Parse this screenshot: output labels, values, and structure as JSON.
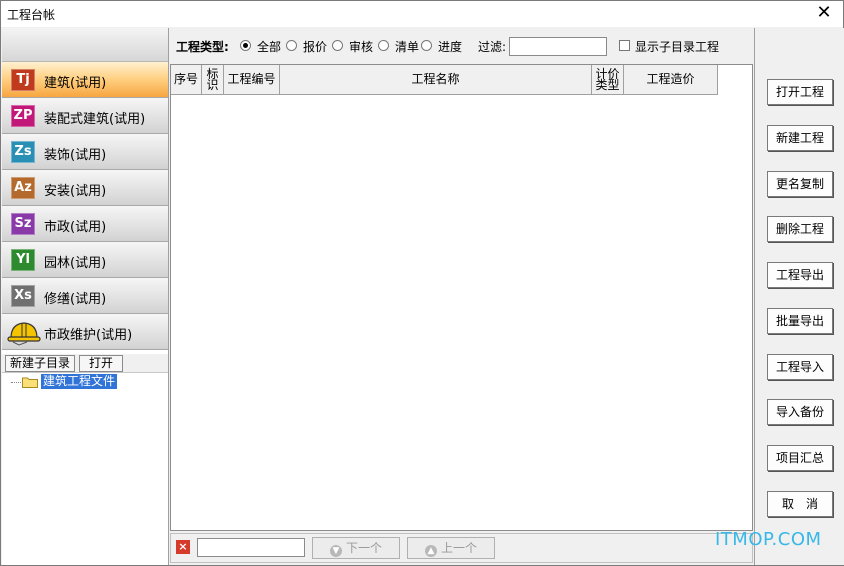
{
  "window": {
    "title": "工程台帐",
    "close_glyph": "✕"
  },
  "sidebar": {
    "categories": [
      {
        "badge": "Tj",
        "label": "建筑(试用)",
        "color": "#c03a1e"
      },
      {
        "badge": "ZP",
        "label": "装配式建筑(试用)",
        "color": "#c2187a"
      },
      {
        "badge": "Zs",
        "label": "装饰(试用)",
        "color": "#2a8fb5"
      },
      {
        "badge": "Az",
        "label": "安装(试用)",
        "color": "#b36a2c"
      },
      {
        "badge": "Sz",
        "label": "市政(试用)",
        "color": "#8a3aa8"
      },
      {
        "badge": "Yl",
        "label": "园林(试用)",
        "color": "#2e8a2e"
      },
      {
        "badge": "Xs",
        "label": "修缮(试用)",
        "color": "#707070"
      },
      {
        "badge": "",
        "label": "市政维护(试用)",
        "icon": "hardhat-icon"
      }
    ],
    "tree_tools": {
      "new_subdir": "新建子目录",
      "open": "打开"
    },
    "tree": {
      "root_label": "建筑工程文件"
    }
  },
  "filter": {
    "type_label": "工程类型:",
    "options": [
      "全部",
      "报价",
      "审核",
      "清单",
      "进度"
    ],
    "selected": "全部",
    "filter_label": "过滤:",
    "filter_value": "",
    "show_subdir_label": "显示子目录工程",
    "show_subdir_checked": false
  },
  "grid": {
    "columns": [
      "序号",
      "标识",
      "工程编号",
      "工程名称",
      "计价类型",
      "工程造价"
    ],
    "rows": []
  },
  "bottom": {
    "search_value": "",
    "next_label": "下一个",
    "prev_label": "上一个"
  },
  "actions": [
    "打开工程",
    "新建工程",
    "更名复制",
    "删除工程",
    "工程导出",
    "批量导出",
    "工程导入",
    "导入备份",
    "项目汇总",
    "取　消"
  ],
  "watermark": "ITMOP.COM"
}
